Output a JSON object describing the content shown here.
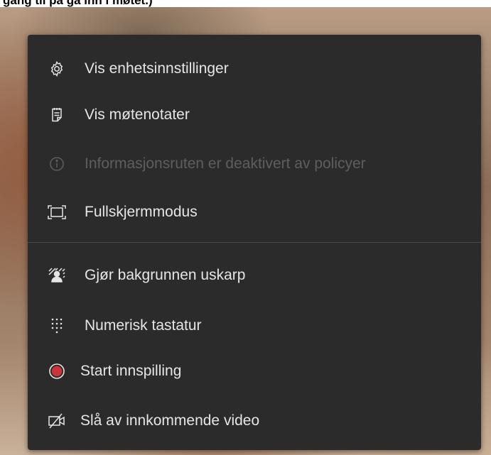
{
  "document": {
    "heading_fragment": "gang til på gå inn i møtet.)"
  },
  "menu": {
    "items": [
      {
        "label": "Vis enhetsinnstillinger",
        "icon": "gear-icon",
        "enabled": true
      },
      {
        "label": "Vis møtenotater",
        "icon": "notes-icon",
        "enabled": true
      },
      {
        "label": "Informasjonsruten er deaktivert av policyer",
        "icon": "info-icon",
        "enabled": false
      },
      {
        "label": "Fullskjermmodus",
        "icon": "fullscreen-icon",
        "enabled": true
      },
      {
        "label": "Gjør bakgrunnen uskarp",
        "icon": "blur-background-icon",
        "enabled": true
      },
      {
        "label": "Numerisk tastatur",
        "icon": "dialpad-icon",
        "enabled": true
      },
      {
        "label": "Start innspilling",
        "icon": "record-icon",
        "enabled": true
      },
      {
        "label": "Slå av innkommende video",
        "icon": "video-off-icon",
        "enabled": true
      }
    ]
  },
  "colors": {
    "menu_background": "#2b2b2b",
    "text": "#e6e6e6",
    "disabled_text": "#5e5e5e",
    "record_red": "#d0323b"
  }
}
